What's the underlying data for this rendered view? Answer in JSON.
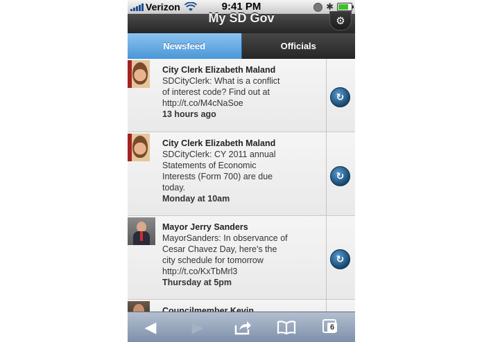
{
  "status_bar": {
    "carrier": "Verizon",
    "time": "9:41 PM",
    "battery_level": 0.8
  },
  "header": {
    "title": "My SD Gov",
    "settings_icon": "gear-icon"
  },
  "tabs": [
    {
      "label": "Newsfeed",
      "active": true
    },
    {
      "label": "Officials",
      "active": false
    }
  ],
  "feed": [
    {
      "name": "City Clerk Elizabeth Maland",
      "message_lines": [
        "SDCityClerk: What is a conflict",
        "of interest code? Find out at",
        "http://t.co/M4cNaSoe"
      ],
      "time": "13 hours ago"
    },
    {
      "name": "City Clerk Elizabeth Maland",
      "message_lines": [
        "SDCityClerk: CY 2011 annual",
        "Statements of Economic",
        "Interests (Form 700) are due",
        "today."
      ],
      "time": "Monday at 10am"
    },
    {
      "name": "Mayor Jerry Sanders",
      "message_lines": [
        "MayorSanders: In observance of",
        "Cesar Chavez Day, here's the",
        "city schedule for tomorrow",
        "http://t.co/KxTbMrl3"
      ],
      "time": "Thursday at 5pm"
    },
    {
      "name": "Councilmember Kevin",
      "message_lines": [],
      "time": ""
    }
  ],
  "toolbar": {
    "pages_count": "6"
  },
  "colors": {
    "tab_active": "#4a97d8",
    "header_bg": "#262626",
    "toolbar_bg": "#7c8fa9"
  }
}
